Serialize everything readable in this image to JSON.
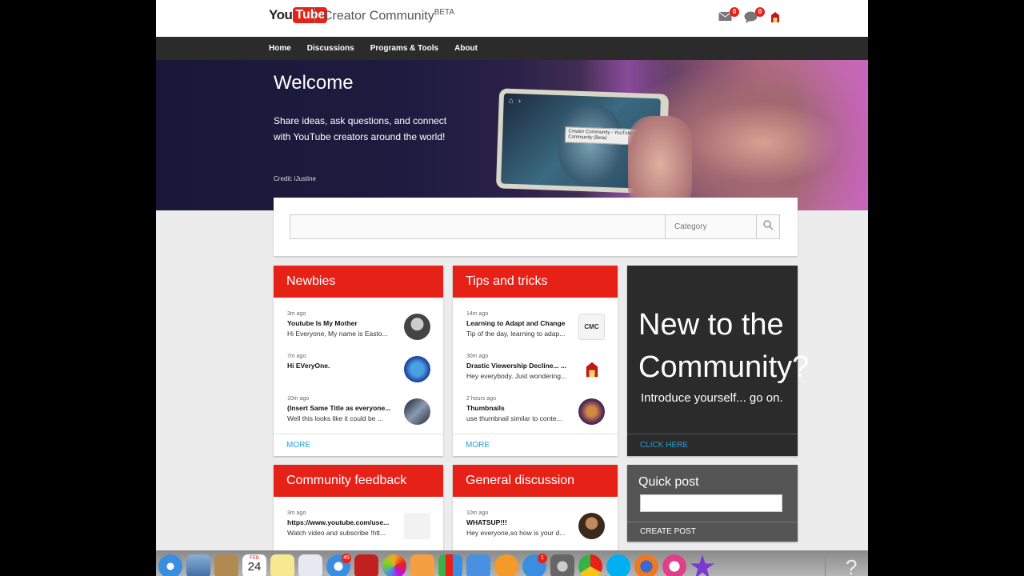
{
  "header": {
    "logo_you": "You",
    "logo_tube": "Tube",
    "site_title": "Creator Community",
    "site_title_sup": "BETA",
    "mail_count": "0",
    "chat_count": "0"
  },
  "nav": {
    "items": [
      {
        "label": "Home"
      },
      {
        "label": "Discussions"
      },
      {
        "label": "Programs & Tools"
      },
      {
        "label": "About"
      }
    ]
  },
  "hero": {
    "title": "Welcome",
    "subtitle": "Share ideas, ask questions, and connect with YouTube creators around the world!",
    "credit": "Credit: iJustine",
    "phone_tooltip": "Creator Community - YouTube Creator Community (Beta)"
  },
  "search": {
    "placeholder": "",
    "category_label": "Category"
  },
  "cards": [
    {
      "title": "Newbies",
      "more": "MORE",
      "posts": [
        {
          "time": "3m ago",
          "title": "Youtube Is My Mother",
          "snippet": "Hi Everyone, My name is Easto...",
          "avatar": "#5a5a5a"
        },
        {
          "time": "7m ago",
          "title": "Hi EVeryOne.",
          "snippet": "",
          "avatar": "#2a4aa8"
        },
        {
          "time": "10m ago",
          "title": "(Insert Same Title as everyone...",
          "snippet": "Well this looks like it could be ...",
          "avatar": "#3a4a6a"
        }
      ]
    },
    {
      "title": "Tips and tricks",
      "more": "MORE",
      "posts": [
        {
          "time": "14m ago",
          "title": "Learning to Adapt and Change",
          "snippet": "Tip of the day, learning to adap...",
          "avatar": "#e8e8e8"
        },
        {
          "time": "30m ago",
          "title": "Drastic Viewership Decline... ...",
          "snippet": "Hey everybody. Just wondering...",
          "avatar": "#f0f0f0"
        },
        {
          "time": "2 hours ago",
          "title": "Thumbnails",
          "snippet": "use thumbnail similar to conte...",
          "avatar": "#6a3a5a"
        }
      ]
    },
    {
      "title": "Community feedback",
      "posts": [
        {
          "time": "3m ago",
          "title": "https://www.youtube.com/use...",
          "snippet": "Watch video and subscribe !htt...",
          "avatar": "#f2f2f2"
        }
      ]
    },
    {
      "title": "General discussion",
      "posts": [
        {
          "time": "10m ago",
          "title": "WHATSUP!!!",
          "snippet": "Hey everyone,so how is your d...",
          "avatar": "#6a4a2a"
        }
      ]
    }
  ],
  "new_community": {
    "title_line1": "New to the",
    "title_line2": "Community?",
    "subtitle": "Introduce yourself... go on.",
    "link": "CLICK HERE"
  },
  "quick_post": {
    "title": "Quick post",
    "button": "CREATE POST"
  },
  "dock": {
    "calendar_month": "FEB",
    "calendar_day": "24",
    "mail_badge": "45",
    "appstore_badge": "1",
    "help": "?"
  },
  "colors": {
    "brand_red": "#e62117",
    "link_blue": "#2a9fd6",
    "nav_dark": "#2b2b2b"
  }
}
